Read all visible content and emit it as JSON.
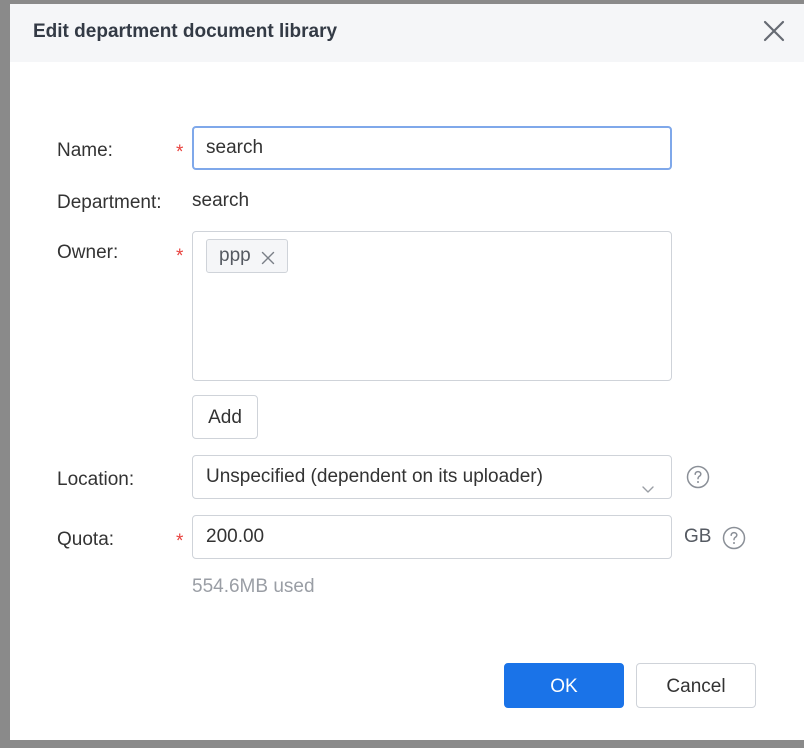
{
  "dialog": {
    "title": "Edit department document library"
  },
  "form": {
    "name": {
      "label": "Name:",
      "required_mark": "*",
      "value": "search"
    },
    "department": {
      "label": "Department:",
      "value": "search"
    },
    "owner": {
      "label": "Owner:",
      "required_mark": "*",
      "tags": [
        "ppp"
      ],
      "add_label": "Add"
    },
    "location": {
      "label": "Location:",
      "selected": "Unspecified (dependent on its uploader)"
    },
    "quota": {
      "label": "Quota:",
      "required_mark": "*",
      "value": "200.00",
      "unit": "GB",
      "usage_hint": "554.6MB used"
    }
  },
  "footer": {
    "ok_label": "OK",
    "cancel_label": "Cancel"
  },
  "icons": {
    "close": "close-icon",
    "tag_remove": "close-icon",
    "dropdown": "chevron-down-icon",
    "help": "question-circle-icon"
  },
  "colors": {
    "primary": "#1a73e8",
    "required": "#e8423e",
    "focus_border": "#7fa8ea",
    "header_bg": "#f5f6f8",
    "hint_text": "#9a9ea5"
  }
}
